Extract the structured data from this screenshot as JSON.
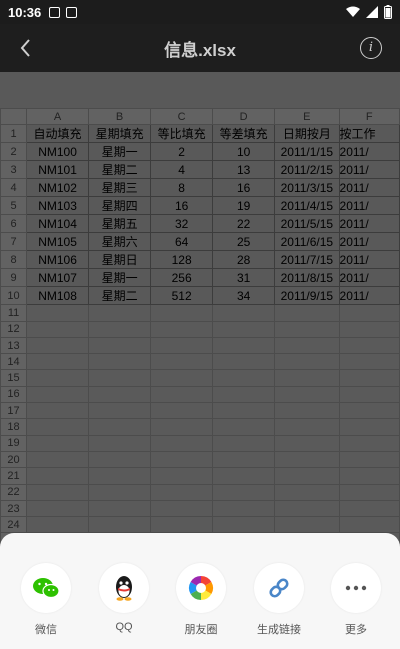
{
  "status": {
    "time": "10:36"
  },
  "header": {
    "title": "信息.xlsx"
  },
  "sheet": {
    "columns": [
      "A",
      "B",
      "C",
      "D",
      "E",
      "F"
    ],
    "row_numbers": [
      "1",
      "2",
      "3",
      "4",
      "5",
      "6",
      "7",
      "8",
      "9",
      "10",
      "11",
      "12",
      "13",
      "14",
      "15",
      "16",
      "17",
      "18",
      "19",
      "20",
      "21",
      "22",
      "23",
      "24",
      "25"
    ],
    "header_row": [
      "自动填充",
      "星期填充",
      "等比填充",
      "等差填充",
      "日期按月",
      "按工作"
    ],
    "rows": [
      [
        "NM100",
        "星期一",
        "2",
        "10",
        "2011/1/15",
        "2011/"
      ],
      [
        "NM101",
        "星期二",
        "4",
        "13",
        "2011/2/15",
        "2011/"
      ],
      [
        "NM102",
        "星期三",
        "8",
        "16",
        "2011/3/15",
        "2011/"
      ],
      [
        "NM103",
        "星期四",
        "16",
        "19",
        "2011/4/15",
        "2011/"
      ],
      [
        "NM104",
        "星期五",
        "32",
        "22",
        "2011/5/15",
        "2011/"
      ],
      [
        "NM105",
        "星期六",
        "64",
        "25",
        "2011/6/15",
        "2011/"
      ],
      [
        "NM106",
        "星期日",
        "128",
        "28",
        "2011/7/15",
        "2011/"
      ],
      [
        "NM107",
        "星期一",
        "256",
        "31",
        "2011/8/15",
        "2011/"
      ],
      [
        "NM108",
        "星期二",
        "512",
        "34",
        "2011/9/15",
        "2011/"
      ]
    ]
  },
  "share": {
    "items": [
      {
        "label": "微信",
        "icon": "wechat-icon"
      },
      {
        "label": "QQ",
        "icon": "qq-icon"
      },
      {
        "label": "朋友圈",
        "icon": "moments-icon"
      },
      {
        "label": "生成链接",
        "icon": "link-icon"
      },
      {
        "label": "更多",
        "icon": "more-icon"
      }
    ]
  }
}
